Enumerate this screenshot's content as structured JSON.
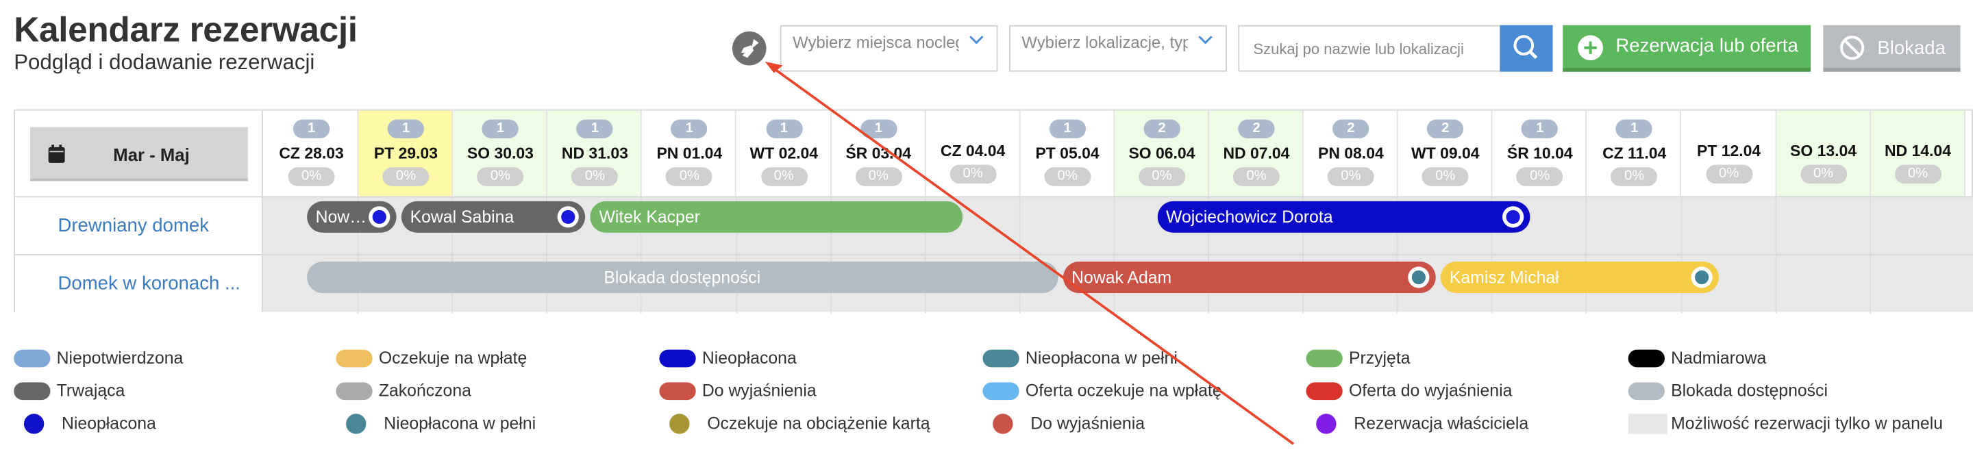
{
  "header": {
    "title": "Kalendarz rezerwacji",
    "subtitle": "Podgląd i dodawanie rezerwacji"
  },
  "toolbar": {
    "place_select_placeholder": "Wybierz miejsca noclegowe",
    "location_select_placeholder": "Wybierz lokalizacje, typ",
    "search_placeholder": "Szukaj po nazwie lub lokalizacji",
    "reservation_button": "Rezerwacja lub oferta",
    "block_button": "Blokada"
  },
  "calendar": {
    "range_label": "Mar - Maj",
    "days": [
      {
        "date": "CZ 28.03",
        "count": "1",
        "pct": "0%",
        "kind": "normal"
      },
      {
        "date": "PT 29.03",
        "count": "1",
        "pct": "0%",
        "kind": "today"
      },
      {
        "date": "SO 30.03",
        "count": "1",
        "pct": "0%",
        "kind": "weekend"
      },
      {
        "date": "ND 31.03",
        "count": "1",
        "pct": "0%",
        "kind": "weekend"
      },
      {
        "date": "PN 01.04",
        "count": "1",
        "pct": "0%",
        "kind": "normal"
      },
      {
        "date": "WT 02.04",
        "count": "1",
        "pct": "0%",
        "kind": "normal"
      },
      {
        "date": "ŚR 03.04",
        "count": "1",
        "pct": "0%",
        "kind": "normal"
      },
      {
        "date": "CZ 04.04",
        "count": "",
        "pct": "0%",
        "kind": "normal"
      },
      {
        "date": "PT 05.04",
        "count": "1",
        "pct": "0%",
        "kind": "normal"
      },
      {
        "date": "SO 06.04",
        "count": "2",
        "pct": "0%",
        "kind": "weekend"
      },
      {
        "date": "ND 07.04",
        "count": "2",
        "pct": "0%",
        "kind": "weekend"
      },
      {
        "date": "PN 08.04",
        "count": "2",
        "pct": "0%",
        "kind": "normal"
      },
      {
        "date": "WT 09.04",
        "count": "2",
        "pct": "0%",
        "kind": "normal"
      },
      {
        "date": "ŚR 10.04",
        "count": "1",
        "pct": "0%",
        "kind": "normal"
      },
      {
        "date": "CZ 11.04",
        "count": "1",
        "pct": "0%",
        "kind": "normal"
      },
      {
        "date": "PT 12.04",
        "count": "",
        "pct": "0%",
        "kind": "normal"
      },
      {
        "date": "SO 13.04",
        "count": "",
        "pct": "0%",
        "kind": "weekend"
      },
      {
        "date": "ND 14.04",
        "count": "",
        "pct": "0%",
        "kind": "weekend"
      }
    ],
    "rows": [
      {
        "name": "Drewniany domek",
        "bookings": [
          {
            "label": "Now…",
            "color": "#666666",
            "dot": "#1a1adf",
            "from_day": 0,
            "to_day": 1
          },
          {
            "label": "Kowal Sabina",
            "color": "#666666",
            "dot": "#1a1adf",
            "from_day": 1,
            "to_day": 3
          },
          {
            "label": "Witek Kacper",
            "color": "#74b866",
            "dot": "",
            "from_day": 3,
            "to_day": 7
          },
          {
            "label": "Wojciechowicz Dorota",
            "color": "#0a0ac8",
            "dot": "#1a1adf",
            "from_day": 9,
            "to_day": 13
          }
        ]
      },
      {
        "name": "Domek w koronach ...",
        "bookings": [
          {
            "label": "Blokada dostępności",
            "color": "#b3bbc3",
            "dot": "",
            "from_day": 0,
            "to_day": 8,
            "center": true
          },
          {
            "label": "Nowak Adam",
            "color": "#c95146",
            "dot": "#3f8296",
            "from_day": 8,
            "to_day": 12
          },
          {
            "label": "Kamisz Michał",
            "color": "#f5cc45",
            "dot": "#3f8296",
            "from_day": 12,
            "to_day": 15
          }
        ]
      }
    ]
  },
  "legend": [
    {
      "label": "Niepotwierdzona",
      "color": "#7fa8d6",
      "shape": "pill"
    },
    {
      "label": "Oczekuje na wpłatę",
      "color": "#f0c060",
      "shape": "pill"
    },
    {
      "label": "Nieopłacona",
      "color": "#0a0ac8",
      "shape": "pill"
    },
    {
      "label": "Nieopłacona w pełni",
      "color": "#4a8796",
      "shape": "pill"
    },
    {
      "label": "Przyjęta",
      "color": "#74b866",
      "shape": "pill"
    },
    {
      "label": "Nadmiarowa",
      "color": "#000000",
      "shape": "pill"
    },
    {
      "label": "Trwająca",
      "color": "#666666",
      "shape": "pill"
    },
    {
      "label": "Zakończona",
      "color": "#aaaaaa",
      "shape": "pill"
    },
    {
      "label": "Do wyjaśnienia",
      "color": "#c95146",
      "shape": "pill"
    },
    {
      "label": "Oferta oczekuje na wpłatę",
      "color": "#68b7ee",
      "shape": "pill"
    },
    {
      "label": "Oferta do wyjaśnienia",
      "color": "#d9342b",
      "shape": "pill"
    },
    {
      "label": "Blokada dostępności",
      "color": "#b3bbc3",
      "shape": "pill"
    },
    {
      "label": "Nieopłacona",
      "color": "#1212c8",
      "shape": "circle"
    },
    {
      "label": "Nieopłacona w pełni",
      "color": "#4a8796",
      "shape": "circle"
    },
    {
      "label": "Oczekuje na obciążenie kartą",
      "color": "#a89635",
      "shape": "circle"
    },
    {
      "label": "Do wyjaśnienia",
      "color": "#c95146",
      "shape": "circle"
    },
    {
      "label": "Rezerwacja właściciela",
      "color": "#7f1de6",
      "shape": "circle"
    },
    {
      "label": "Możliwość rezerwacji tylko w panelu",
      "color": "#e6e6e6",
      "shape": "square"
    }
  ],
  "colors": {
    "accent_blue": "#4a89d4",
    "accent_green": "#5cb85c",
    "annotation_arrow": "#e8462a"
  }
}
